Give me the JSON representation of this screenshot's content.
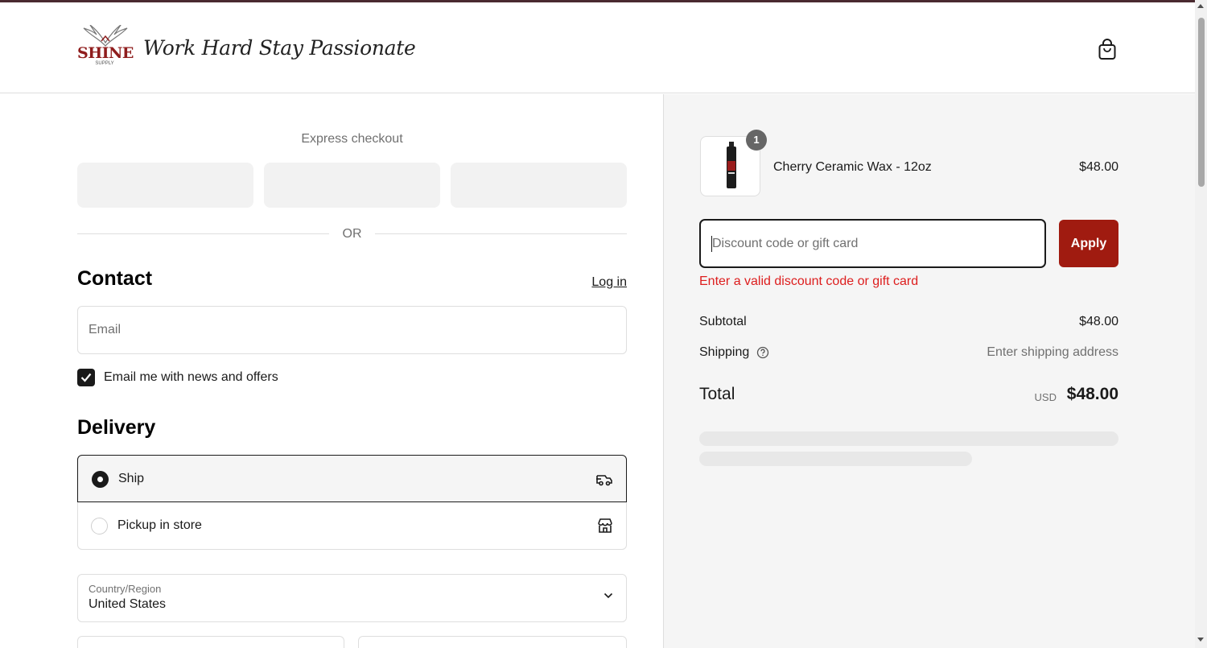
{
  "header": {
    "logo_text": "SHINE",
    "logo_subtext": "SUPPLY",
    "tagline": "Work Hard Stay Passionate",
    "cart_icon": "shopping-bag-icon"
  },
  "express": {
    "label": "Express checkout",
    "or_text": "OR"
  },
  "contact": {
    "title": "Contact",
    "login_label": "Log in",
    "email_placeholder": "Email",
    "newsletter_label": "Email me with news and offers",
    "newsletter_checked": true
  },
  "delivery": {
    "title": "Delivery",
    "options": [
      {
        "label": "Ship",
        "icon": "truck-icon",
        "selected": true
      },
      {
        "label": "Pickup in store",
        "icon": "store-icon",
        "selected": false
      }
    ],
    "country_label": "Country/Region",
    "country_value": "United States"
  },
  "summary": {
    "item": {
      "name": "Cherry Ceramic Wax - 12oz",
      "price": "$48.00",
      "quantity": "1"
    },
    "discount_placeholder": "Discount code or gift card",
    "apply_label": "Apply",
    "error_text": "Enter a valid discount code or gift card",
    "subtotal_label": "Subtotal",
    "subtotal_value": "$48.00",
    "shipping_label": "Shipping",
    "shipping_value": "Enter shipping address",
    "total_label": "Total",
    "currency": "USD",
    "total_value": "$48.00"
  },
  "colors": {
    "accent": "#a01b10",
    "error": "#dd1d1d",
    "text": "#1a1a1a",
    "muted": "#707070"
  }
}
